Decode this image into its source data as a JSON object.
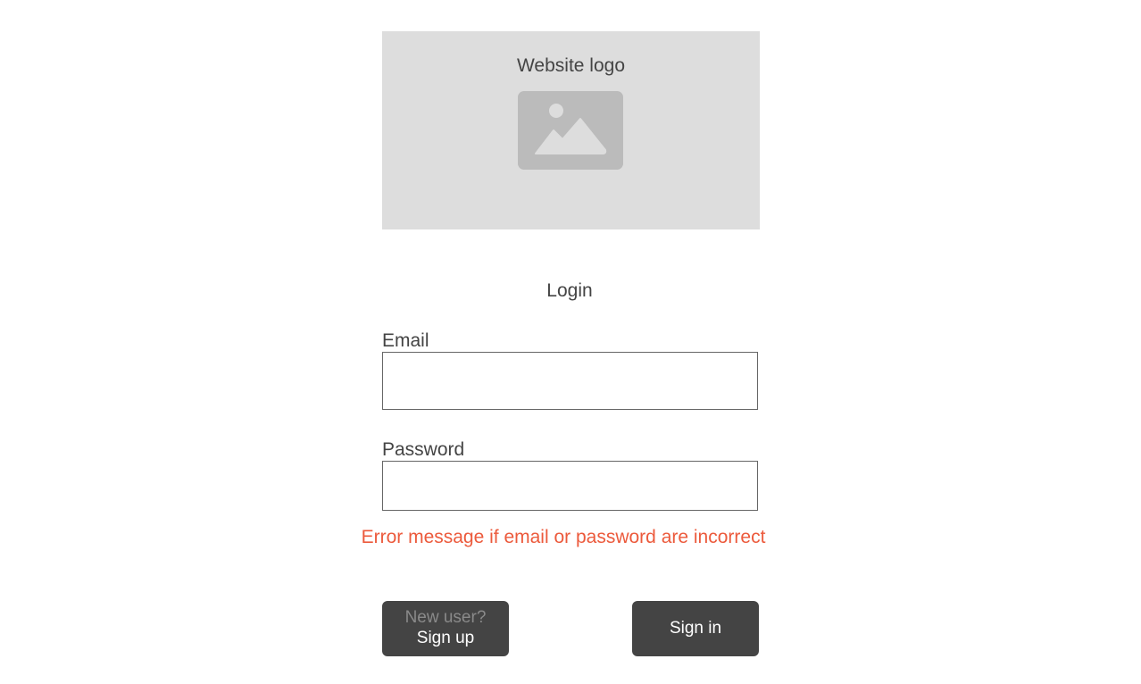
{
  "logo": {
    "label": "Website logo",
    "icon": "image-placeholder-icon"
  },
  "login": {
    "title": "Login",
    "email": {
      "label": "Email",
      "value": "",
      "placeholder": ""
    },
    "password": {
      "label": "Password",
      "value": "",
      "placeholder": ""
    },
    "error_message": "Error message if email or password are incorrect"
  },
  "buttons": {
    "signup_hint": "New user?",
    "signup_label": "Sign up",
    "signin_label": "Sign in"
  },
  "colors": {
    "error": "#ec5a3c",
    "button_bg": "#444444",
    "logo_bg": "#dddddd",
    "text": "#444444"
  }
}
